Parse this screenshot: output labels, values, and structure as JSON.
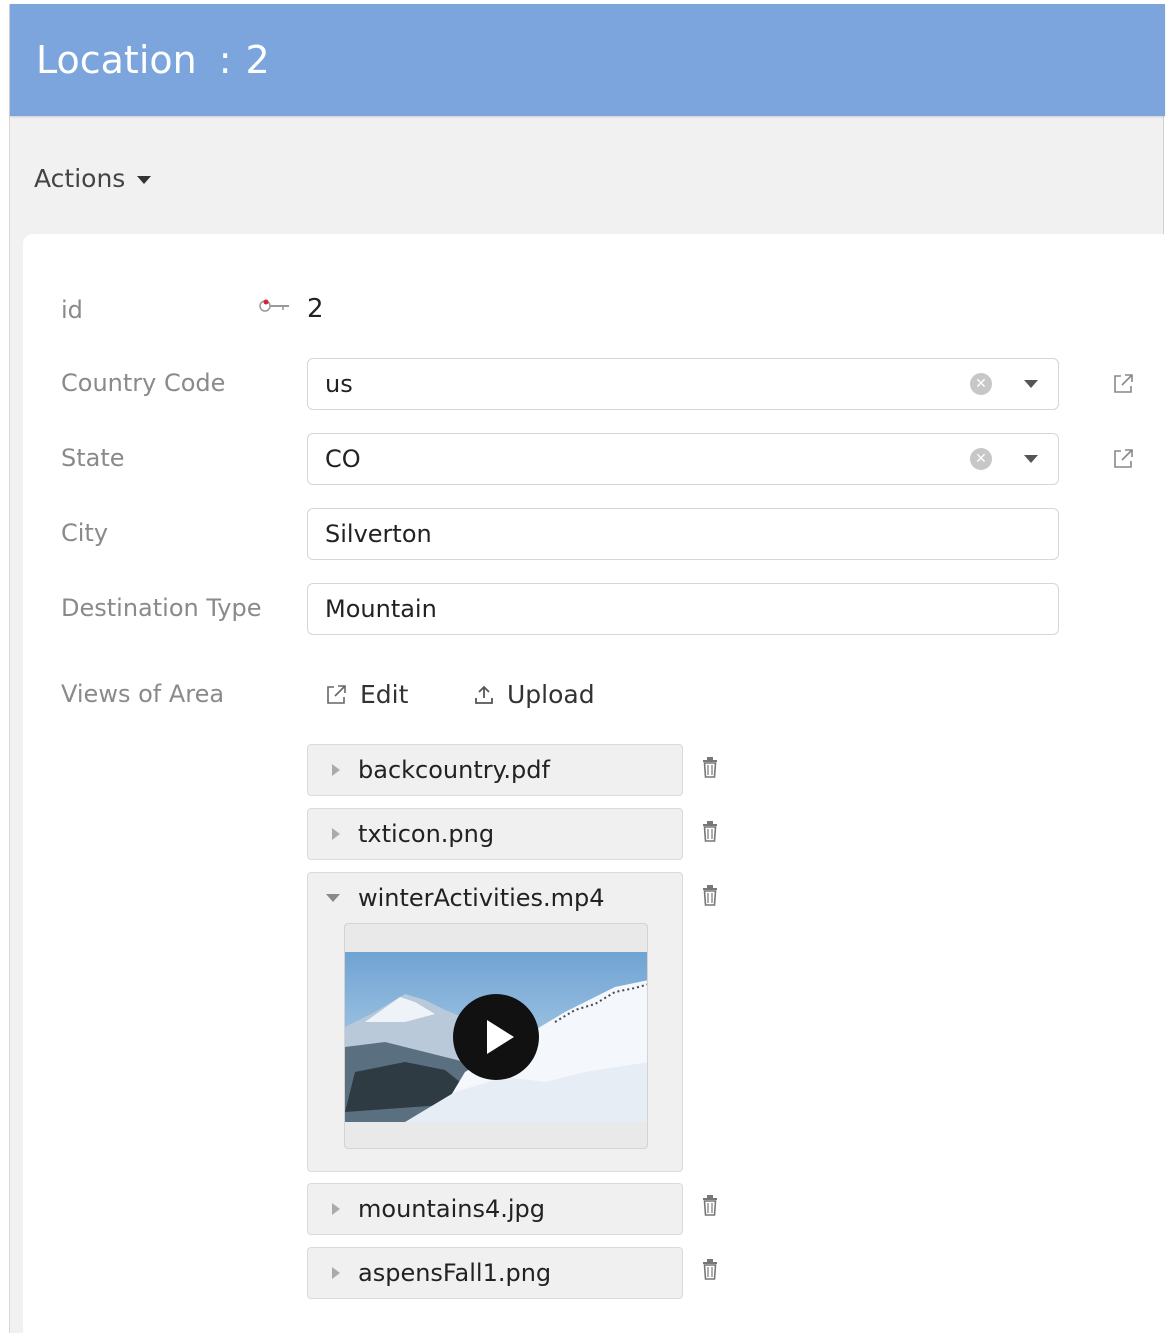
{
  "header": {
    "title": "Location",
    "separator": ":",
    "record_id": "2"
  },
  "toolbar": {
    "actions_label": "Actions"
  },
  "form": {
    "id": {
      "label": "id",
      "value": "2"
    },
    "country_code": {
      "label": "Country Code",
      "value": "us"
    },
    "state": {
      "label": "State",
      "value": "CO"
    },
    "city": {
      "label": "City",
      "value": "Silverton"
    },
    "destination_type": {
      "label": "Destination Type",
      "value": "Mountain"
    },
    "views": {
      "label": "Views of Area",
      "edit_label": "Edit",
      "upload_label": "Upload",
      "files": [
        {
          "name": "backcountry.pdf",
          "expanded": false
        },
        {
          "name": "txticon.png",
          "expanded": false
        },
        {
          "name": "winterActivities.mp4",
          "expanded": true
        },
        {
          "name": "mountains4.jpg",
          "expanded": false
        },
        {
          "name": "aspensFall1.png",
          "expanded": false
        }
      ]
    }
  },
  "colors": {
    "header_bg": "#7ba5dc",
    "panel_bg": "#f1f1f1",
    "card_bg": "#ffffff",
    "label": "#8a8a8a"
  },
  "icons": [
    "key-icon",
    "clear-icon",
    "dropdown-icon",
    "external-link-icon",
    "upload-icon",
    "trash-icon",
    "expand-icon",
    "play-icon"
  ]
}
